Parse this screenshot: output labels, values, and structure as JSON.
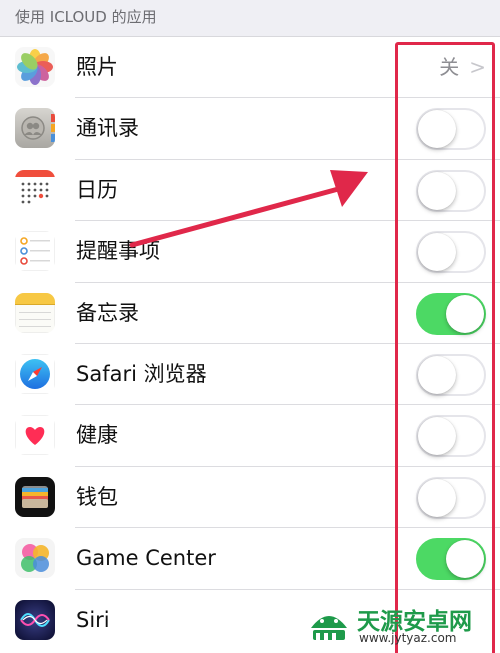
{
  "section_header": "使用 ICLOUD 的应用",
  "rows": [
    {
      "label": "照片",
      "icon": "photos-icon",
      "control": "detail",
      "value": "关"
    },
    {
      "label": "通讯录",
      "icon": "contacts-icon",
      "control": "toggle",
      "on": false
    },
    {
      "label": "日历",
      "icon": "calendar-icon",
      "control": "toggle",
      "on": false
    },
    {
      "label": "提醒事项",
      "icon": "reminders-icon",
      "control": "toggle",
      "on": false
    },
    {
      "label": "备忘录",
      "icon": "notes-icon",
      "control": "toggle",
      "on": true
    },
    {
      "label": "Safari 浏览器",
      "icon": "safari-icon",
      "control": "toggle",
      "on": false
    },
    {
      "label": "健康",
      "icon": "health-icon",
      "control": "toggle",
      "on": false
    },
    {
      "label": "钱包",
      "icon": "wallet-icon",
      "control": "toggle",
      "on": false
    },
    {
      "label": "Game Center",
      "icon": "game-center-icon",
      "control": "toggle",
      "on": true
    },
    {
      "label": "Siri",
      "icon": "siri-icon",
      "control": "none"
    }
  ],
  "chevron": ">",
  "colors": {
    "toggle_on": "#4cd964",
    "annotation": "#e0284a",
    "watermark": "#1e9a4a"
  },
  "watermark": {
    "title": "天源安卓网",
    "url": "www.jytyaz.com"
  }
}
